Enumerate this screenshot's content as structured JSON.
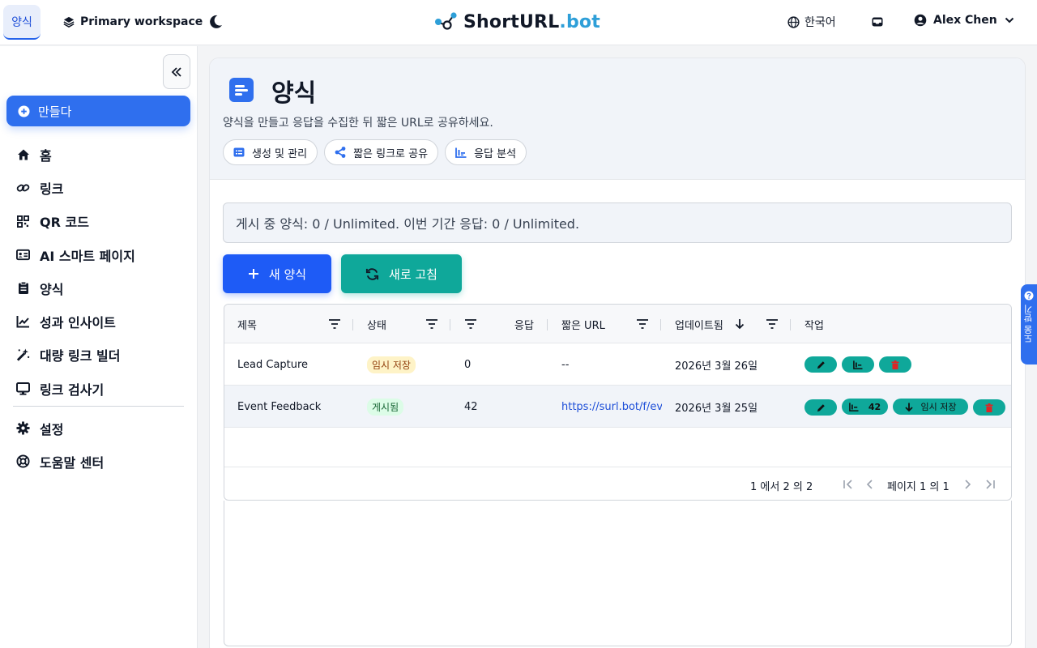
{
  "topbar": {
    "active_tab": "양식",
    "workspace": "Primary workspace",
    "brand_main": "ShortURL",
    "brand_accent": ".bot",
    "language": "한국어",
    "user_name": "Alex Chen"
  },
  "sidebar": {
    "create_label": "만들다",
    "items": [
      {
        "label": "홈",
        "icon": "home-icon"
      },
      {
        "label": "링크",
        "icon": "link-icon"
      },
      {
        "label": "QR 코드",
        "icon": "qr-icon"
      },
      {
        "label": "AI 스마트 페이지",
        "icon": "id-card-icon"
      },
      {
        "label": "양식",
        "icon": "clipboard-icon"
      },
      {
        "label": "성과 인사이트",
        "icon": "chart-line-icon"
      },
      {
        "label": "대량 링크 빌더",
        "icon": "magic-wand-icon"
      },
      {
        "label": "링크 검사기",
        "icon": "monitor-icon"
      }
    ],
    "bottom_items": [
      {
        "label": "설정",
        "icon": "gear-icon"
      },
      {
        "label": "도움말 센터",
        "icon": "lifebuoy-icon"
      }
    ]
  },
  "page": {
    "title": "양식",
    "description": "양식을 만들고 응답을 수집한 뒤 짧은 URL로 공유하세요.",
    "pills": [
      "생성 및 관리",
      "짧은 링크로 공유",
      "응답 분석"
    ],
    "quota_text": "게시 중 양식: 0 / Unlimited. 이번 기간 응답: 0 / Unlimited.",
    "new_button": "새 양식",
    "refresh_button": "새로 고침"
  },
  "table": {
    "columns": [
      "제목",
      "상태",
      "응답",
      "짧은 URL",
      "업데이트됨",
      "작업"
    ],
    "rows": [
      {
        "title": "Lead Capture",
        "status": "임시 저장",
        "responses": "0",
        "short_url": "--",
        "updated": "2026년 3월 26일"
      },
      {
        "title": "Event Feedback",
        "status": "게시됨",
        "responses": "42",
        "short_url": "https://surl.bot/f/eve",
        "updated": "2026년 3월 25일",
        "stats_count": "42",
        "unpublish_label": "임시 저장"
      }
    ],
    "footer_range": "1 에서 2 의 2",
    "footer_page": "페이지 1 의 1"
  },
  "help_tab": "도움 받기",
  "colors": {
    "primary": "#2f6fee",
    "teal": "#0fa89a",
    "brand_accent": "#2e9fd8"
  }
}
